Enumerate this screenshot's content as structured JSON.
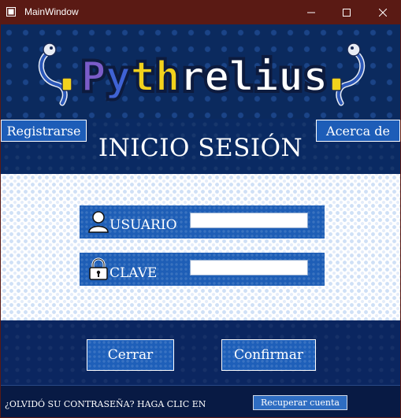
{
  "window": {
    "title": "MainWindow",
    "controls": [
      "minimize",
      "maximize",
      "close"
    ]
  },
  "header": {
    "logo_text": "Pythrelius",
    "logo_colors": [
      "#7b5cc9",
      "#3f62d4",
      "#f2d21c",
      "#ffffff"
    ]
  },
  "nav": {
    "register_label": "Registrarse",
    "about_label": "Acerca de"
  },
  "main": {
    "title": "INICIO SESIÓN"
  },
  "form": {
    "user_label": "USUARIO",
    "user_value": "",
    "password_label": "CLAVE",
    "password_value": ""
  },
  "actions": {
    "close_label": "Cerrar",
    "confirm_label": "Confirmar"
  },
  "footer": {
    "forgot_text": "¿OLVIDÓ SU CONTRASEÑA? HAGA CLIC EN",
    "recover_label": "Recuperar cuenta"
  },
  "colors": {
    "titlebar": "#5a1a14",
    "accent": "#1e5eb6",
    "dark_band": "#0b2660"
  }
}
